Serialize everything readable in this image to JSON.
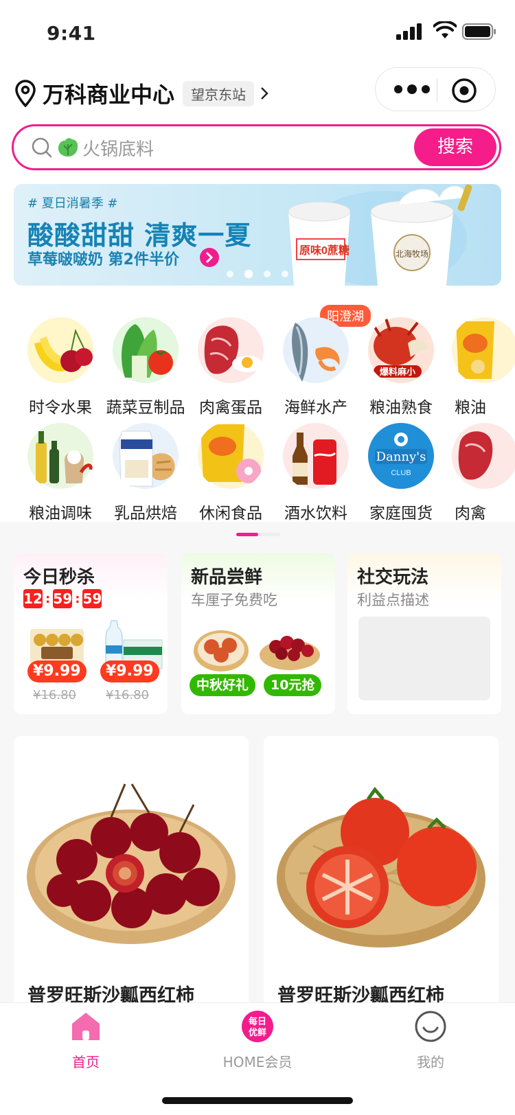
{
  "status": {
    "time": "9:41"
  },
  "location": {
    "name": "万科商业中心",
    "tag": "望京东站"
  },
  "search": {
    "placeholder": "火锅底料",
    "button": "搜索"
  },
  "banner": {
    "tag": "# 夏日消暑季 #",
    "title": "酸酸甜甜 清爽一夏",
    "subtitle": "草莓啵啵奶 第2件半价",
    "product_label_1": "原味0蔗糖",
    "product_label_2": "北海牧场",
    "active_dot": 1,
    "dot_count": 4
  },
  "categories": {
    "badge": "阳澄湖",
    "row1": [
      "时令水果",
      "蔬菜豆制品",
      "肉禽蛋品",
      "海鲜水产",
      "粮油熟食",
      "粮油"
    ],
    "row2": [
      "粮油调味",
      "乳品烘焙",
      "休闲食品",
      "酒水饮料",
      "家庭囤货",
      "肉禽"
    ],
    "row1_icons": [
      "fruit-icon",
      "vegetable-icon",
      "meat-egg-icon",
      "seafood-icon",
      "crayfish-icon",
      "snack-bag-icon"
    ],
    "row2_icons": [
      "oil-seasoning-icon",
      "milk-bread-icon",
      "chips-icon",
      "drinks-icon",
      "dannys-club-icon",
      "meat-icon"
    ],
    "crayfish_label": "爆料麻小"
  },
  "cards": {
    "seckill": {
      "title": "今日秒杀",
      "timer": [
        "12",
        "59",
        "59"
      ],
      "items": [
        {
          "price": "¥9.99",
          "original": "¥16.80",
          "image": "ferrero-chocolate"
        },
        {
          "price": "¥9.99",
          "original": "¥16.80",
          "image": "bottled-water"
        }
      ]
    },
    "newitems": {
      "title": "新品尝鲜",
      "subtitle": "车厘子免费吃",
      "pills": [
        "中秋好礼",
        "10元抢"
      ]
    },
    "social": {
      "title": "社交玩法",
      "subtitle": "利益点描述"
    }
  },
  "products": [
    {
      "name": "普罗旺斯沙瓤西红柿",
      "image": "cherries"
    },
    {
      "name": "普罗旺斯沙瓤西红柿",
      "image": "tomatoes"
    }
  ],
  "tabbar": {
    "items": [
      {
        "label": "首页",
        "icon": "home-icon",
        "active": true
      },
      {
        "label": "HOME会员",
        "icon": "member-icon",
        "icon_text": "每日\n优鲜"
      },
      {
        "label": "我的",
        "icon": "smile-icon"
      }
    ]
  },
  "colors": {
    "accent": "#f01d8d",
    "price": "#ff3b1f",
    "green": "#33b800",
    "banner": "#1583b5"
  }
}
